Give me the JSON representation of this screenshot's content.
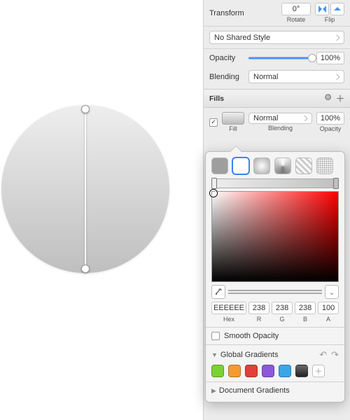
{
  "transform": {
    "label": "Transform",
    "angle": "0°",
    "rotate_label": "Rotate",
    "flip_label": "Flip"
  },
  "style_select": "No Shared Style",
  "opacity": {
    "label": "Opacity",
    "value": "100%",
    "percent": 100
  },
  "blending": {
    "label": "Blending",
    "value": "Normal"
  },
  "fills": {
    "title": "Fills",
    "checked": true,
    "fill_label": "Fill",
    "blending_label": "Blending",
    "blending_value": "Normal",
    "opacity_label": "Opacity",
    "opacity_value": "100%"
  },
  "popover": {
    "types": [
      "solid",
      "linear",
      "radial",
      "angular",
      "pattern",
      "noise"
    ],
    "selected_type": "linear",
    "hex": "EEEEEE",
    "r": "238",
    "g": "238",
    "b": "238",
    "a": "100",
    "hex_label": "Hex",
    "r_label": "R",
    "g_label": "G",
    "b_label": "B",
    "a_label": "A",
    "smooth_opacity_label": "Smooth Opacity",
    "smooth_opacity_checked": false,
    "global_gradients_label": "Global Gradients",
    "document_gradients_label": "Document Gradients",
    "swatches": [
      "#7bd133",
      "#f39b2e",
      "#e04038",
      "#8b59d9",
      "#3aa6e9",
      "#4a4a4a"
    ]
  },
  "chart_data": null
}
